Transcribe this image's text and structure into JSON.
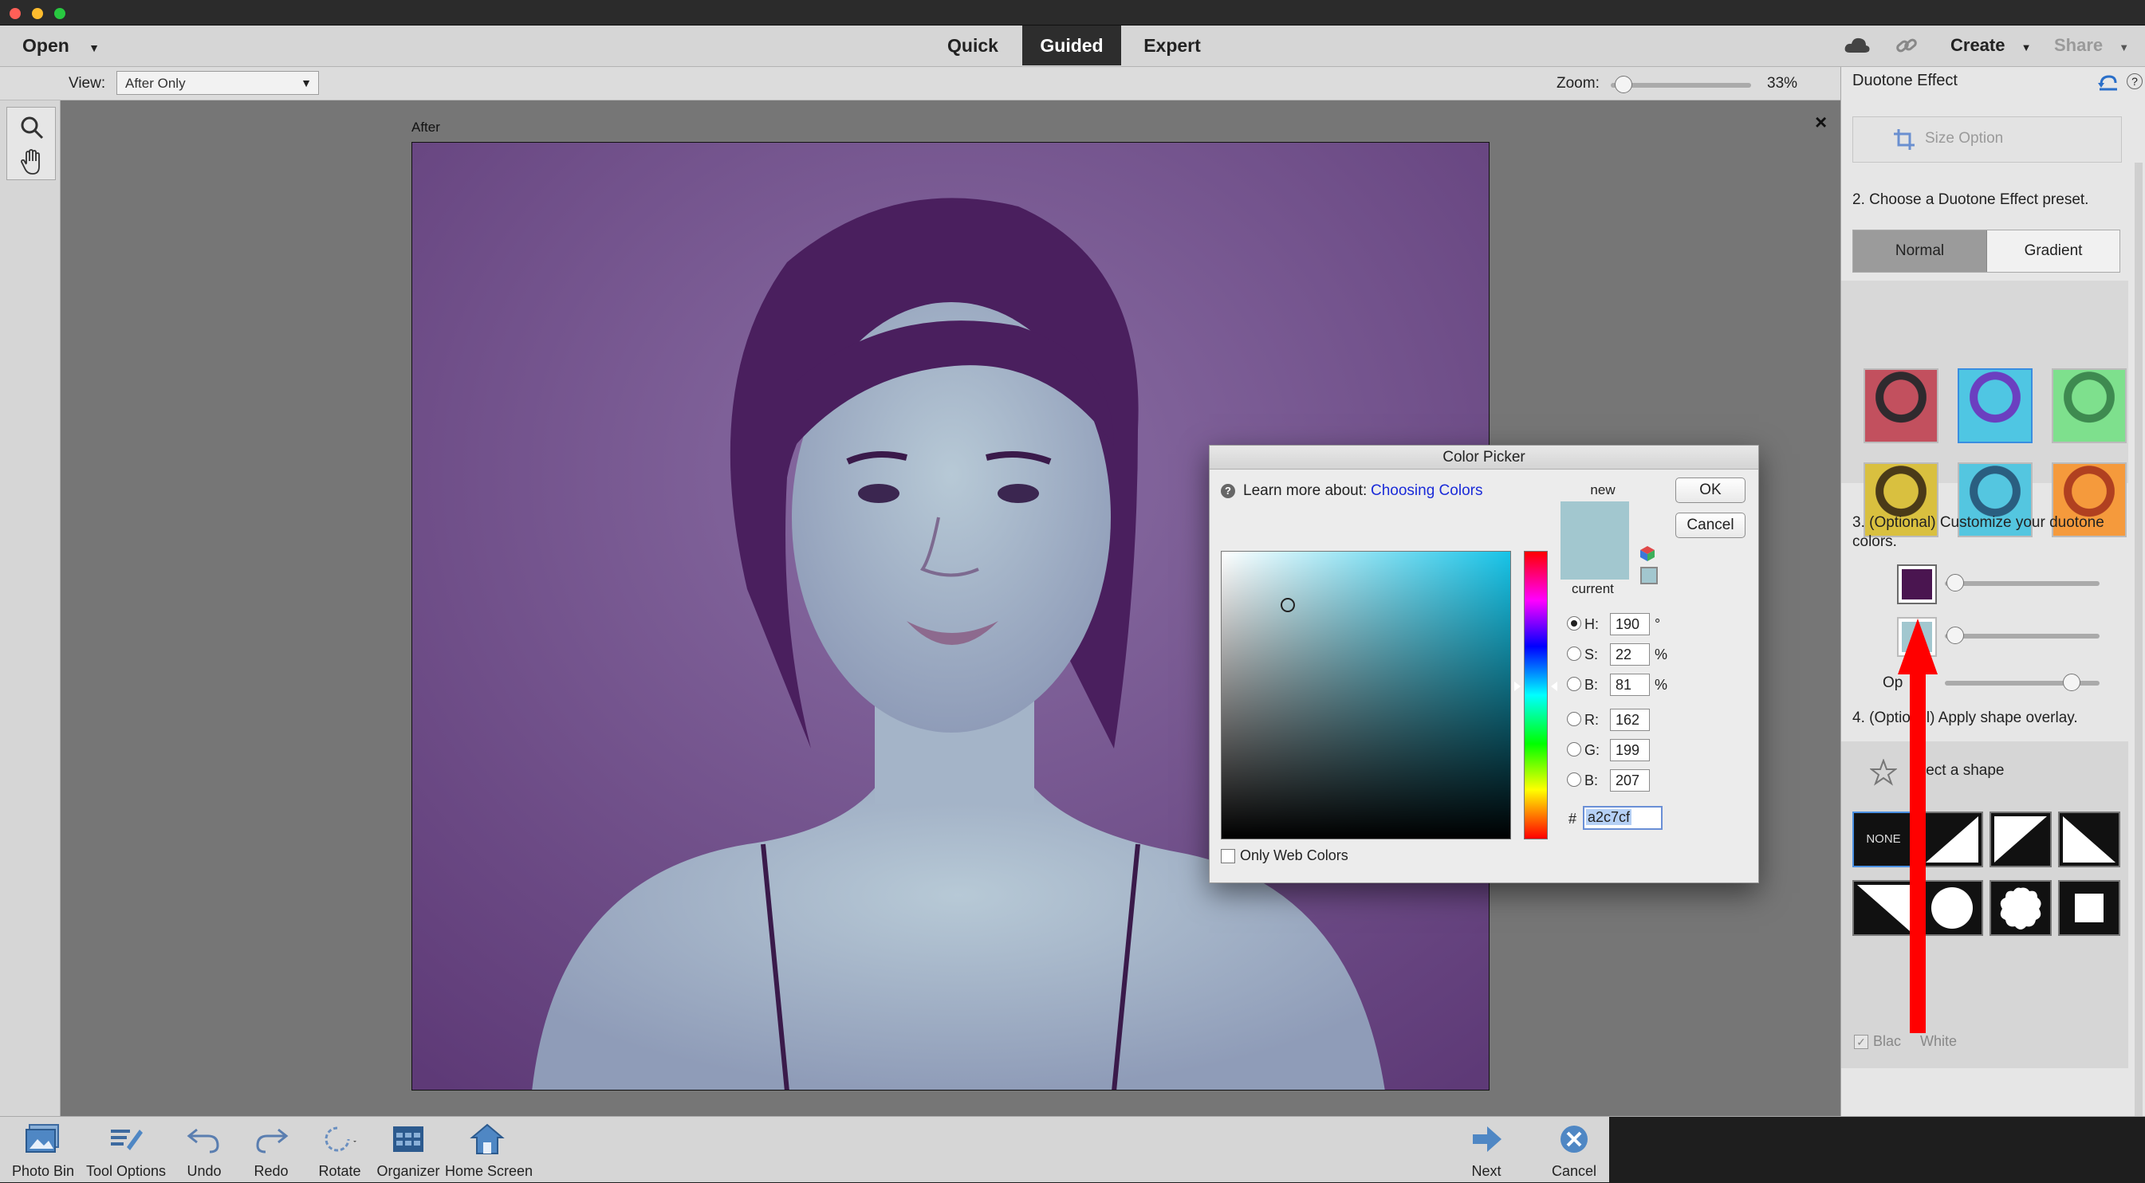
{
  "menubar": {
    "open_label": "Open",
    "modes": [
      "Quick",
      "Guided",
      "Expert"
    ],
    "active_mode": "Guided",
    "create_label": "Create",
    "share_label": "Share"
  },
  "options_bar": {
    "view_label": "View:",
    "view_value": "After Only",
    "zoom_label": "Zoom:",
    "zoom_value": "33%",
    "zoom_level": 0.03
  },
  "canvas": {
    "after_label": "After",
    "close_glyph": "×"
  },
  "right_panel": {
    "title": "Duotone Effect",
    "size_option": "Size Option",
    "step2": "2. Choose a Duotone Effect preset.",
    "preset_tabs": [
      "Normal",
      "Gradient"
    ],
    "active_tab": "Normal",
    "preset_colors": [
      [
        "#c2505e",
        "#2f2a2e"
      ],
      [
        "#4fc6e3",
        "#6b3fc0"
      ],
      [
        "#7ee08d",
        "#3e8a50"
      ],
      [
        "#d9c03f",
        "#4a3a18"
      ],
      [
        "#54c6e0",
        "#2a5e80"
      ],
      [
        "#f59a3c",
        "#b04020"
      ]
    ],
    "step3": "3. (Optional) Customize your duotone colors.",
    "color1": "#4a1550",
    "color2": "#a2c7cf",
    "opacity_label": "Op",
    "step4": "4. (Optio",
    "step4_tail": "l) Apply shape overlay.",
    "select_shape": "lect a shape",
    "none_label": "NONE",
    "bw_label_a": "Blac",
    "bw_label_b": "White"
  },
  "color_picker": {
    "title": "Color Picker",
    "learn_more": "Learn more about:",
    "learn_link": "Choosing Colors",
    "new_label": "new",
    "current_label": "current",
    "ok_label": "OK",
    "cancel_label": "Cancel",
    "fields": [
      {
        "label": "H:",
        "value": "190",
        "unit": "°"
      },
      {
        "label": "S:",
        "value": "22",
        "unit": "%"
      },
      {
        "label": "B:",
        "value": "81",
        "unit": "%"
      },
      {
        "label": "R:",
        "value": "162",
        "unit": ""
      },
      {
        "label": "G:",
        "value": "199",
        "unit": ""
      },
      {
        "label": "B:",
        "value": "207",
        "unit": ""
      }
    ],
    "hash": "#",
    "hex_value": "a2c7cf",
    "web_colors_label": "Only Web Colors",
    "swatch_color": "#a2c7cf",
    "hue_color": "#18c4e8"
  },
  "bottom_bar": {
    "buttons": [
      "Photo Bin",
      "Tool Options",
      "Undo",
      "Redo",
      "Rotate",
      "Organizer",
      "Home Screen"
    ],
    "next_label": "Next",
    "cancel_label": "Cancel"
  },
  "annotation": {
    "arrow_color": "#ff0000"
  }
}
